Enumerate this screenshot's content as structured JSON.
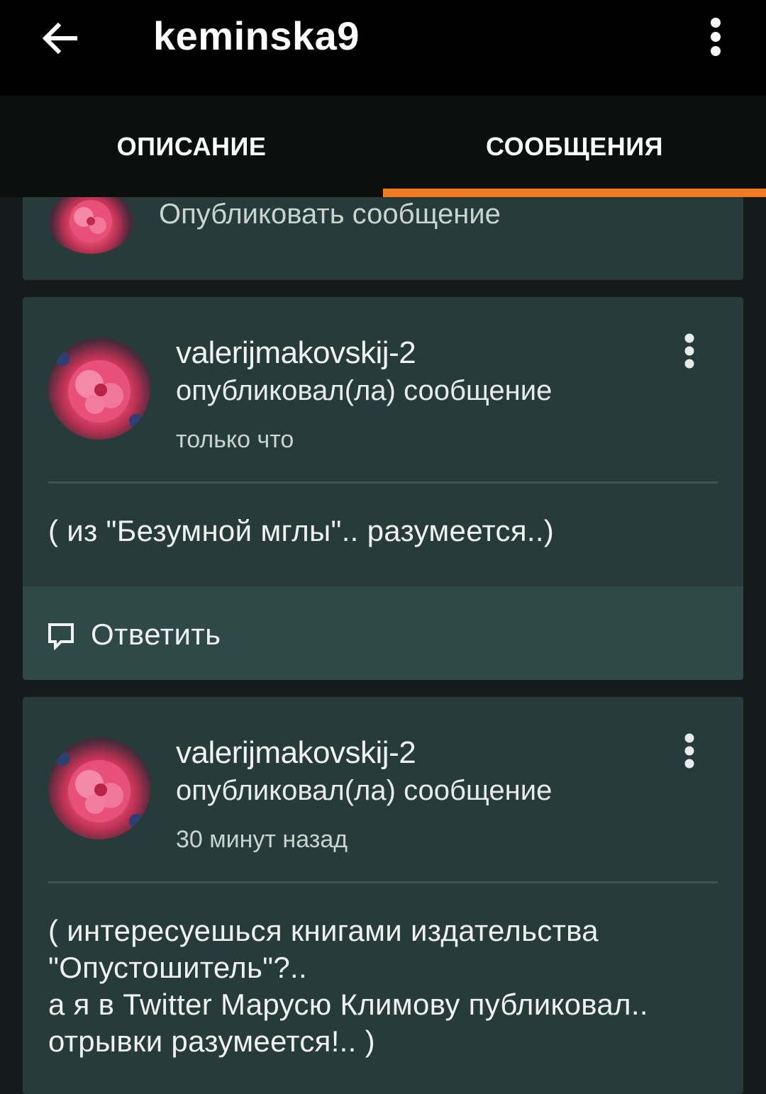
{
  "app_bar": {
    "title": "keminska9",
    "back_icon": "arrow-left-icon",
    "more_icon": "more-vertical-icon"
  },
  "tabs": [
    {
      "label": "ОПИСАНИЕ",
      "selected": false
    },
    {
      "label": "СООБЩЕНИЯ",
      "selected": true
    }
  ],
  "colors": {
    "accent": "#f37a1f",
    "card": "#273b3a",
    "background": "#141b1a",
    "header": "#000000"
  },
  "compose": {
    "placeholder": "Опубликовать сообщение"
  },
  "posts": [
    {
      "user": "valerijmakovskij-2",
      "action": "опубликовал(ла) сообщение",
      "time": "только что",
      "body": "( из \"Безумной мглы\"..  разумеется..)",
      "reply_label": "Ответить"
    },
    {
      "user": "valerijmakovskij-2",
      "action": "опубликовал(ла) сообщение",
      "time": "30 минут назад",
      "body_lines": [
        "( интересуешься книгами издательства",
        "\"Опустошитель\"?..",
        "а я в Twitter  Марусю Климову публиковал..",
        "отрывки разумеется!..  )"
      ]
    }
  ]
}
